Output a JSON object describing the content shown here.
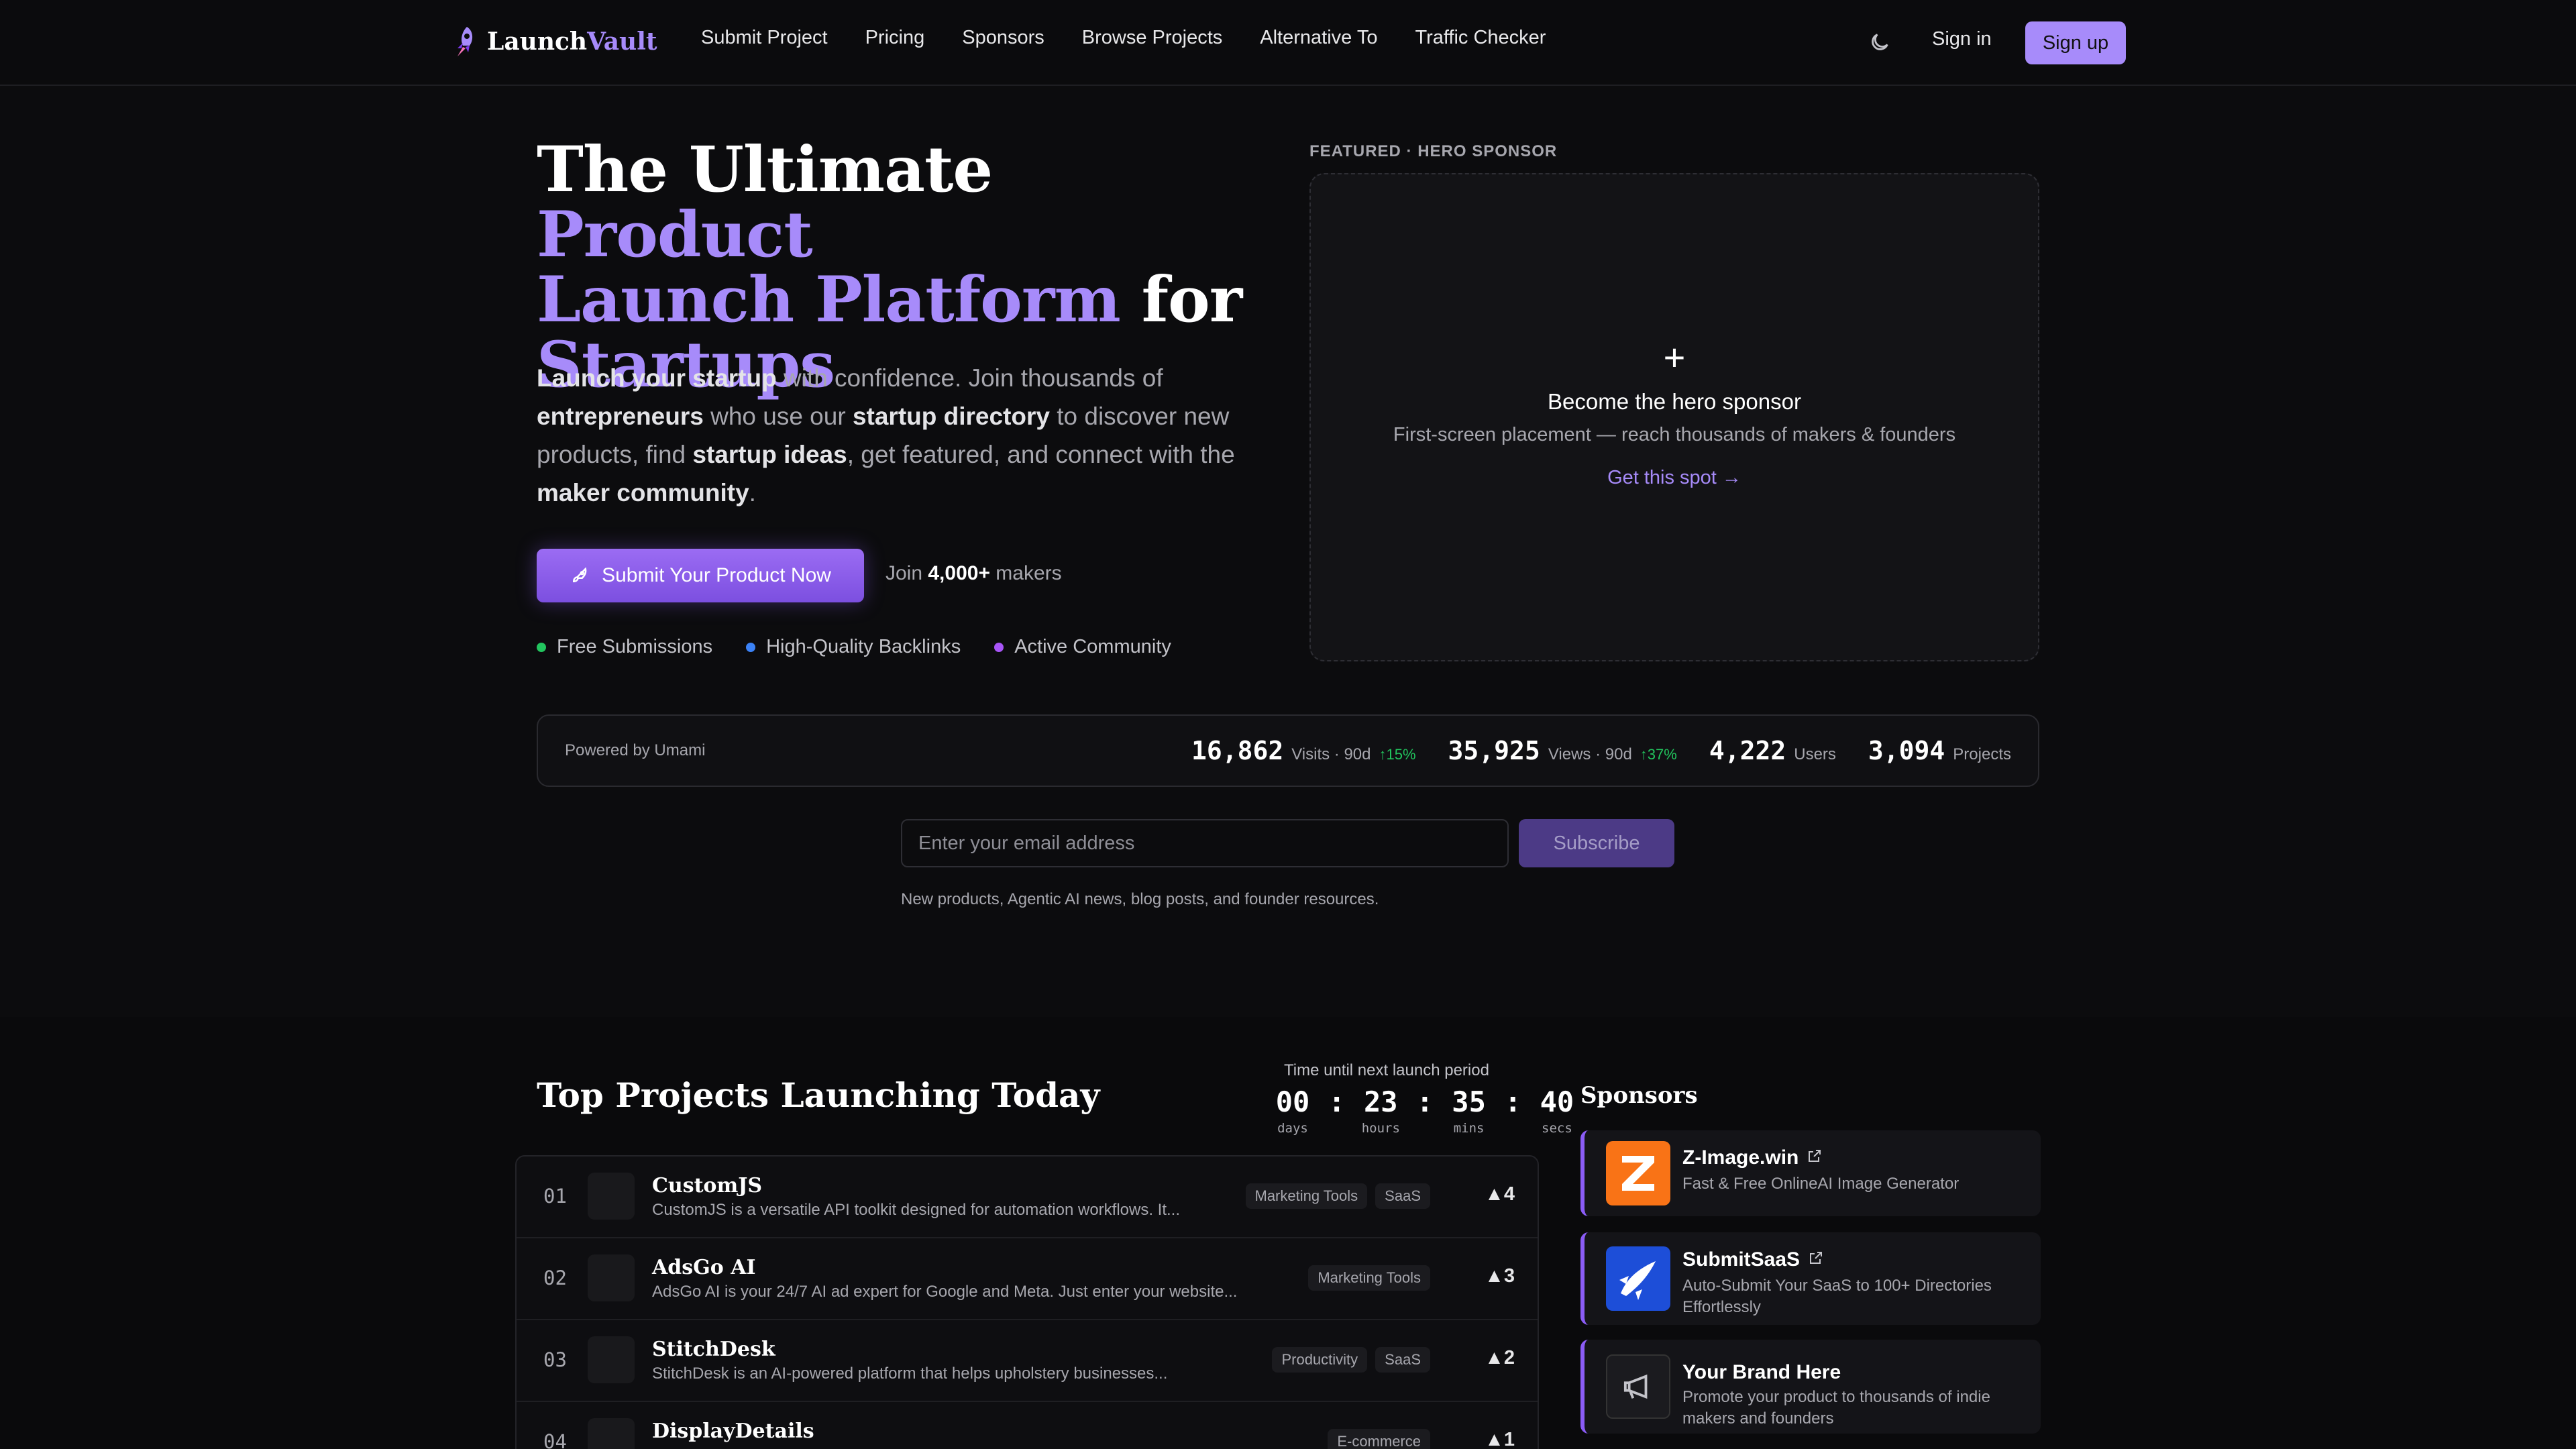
{
  "nav": {
    "logo_part1": "Launch",
    "logo_part2": "Vault",
    "links": [
      "Submit Project",
      "Pricing",
      "Sponsors",
      "Browse Projects",
      "Alternative To",
      "Traffic Checker"
    ],
    "sign_in": "Sign in",
    "sign_up": "Sign up"
  },
  "hero": {
    "title_a": "The Ultimate ",
    "title_b": "Product",
    "title_c": "Launch Platform",
    "title_d": " for",
    "title_e": "Startups",
    "desc": [
      {
        "b": "Launch your startup"
      },
      {
        "t": " with confidence. Join thousands of "
      },
      {
        "b": "entrepreneurs"
      },
      {
        "t": " who use our "
      },
      {
        "b": "startup directory"
      },
      {
        "t": " to discover new products, find "
      },
      {
        "b": "startup ideas"
      },
      {
        "t": ", get featured, and connect with the "
      },
      {
        "b": "maker community"
      },
      {
        "t": "."
      }
    ],
    "cta": "Submit Your Product Now",
    "join_pre": "Join ",
    "join_num": "4,000+",
    "join_post": " makers",
    "bullets": [
      {
        "label": "Free Submissions",
        "color": "#22c55e"
      },
      {
        "label": "High-Quality Backlinks",
        "color": "#3b82f6"
      },
      {
        "label": "Active Community",
        "color": "#a855f7"
      }
    ]
  },
  "hero_sponsor": {
    "label": "FEATURED · HERO SPONSOR",
    "plus": "+",
    "title": "Become the hero sponsor",
    "subtitle": "First-screen placement — reach thousands of makers & founders",
    "link": "Get this spot →"
  },
  "stats": {
    "powered": "Powered by Umami",
    "items": [
      {
        "num": "16,862",
        "label": "Visits · 90d",
        "delta": "↑15%"
      },
      {
        "num": "35,925",
        "label": "Views · 90d",
        "delta": "↑37%"
      },
      {
        "num": "4,222",
        "label": "Users",
        "delta": ""
      },
      {
        "num": "3,094",
        "label": "Projects",
        "delta": ""
      }
    ]
  },
  "newsletter": {
    "placeholder": "Enter your email address",
    "button": "Subscribe",
    "note": "New products, Agentic AI news, blog posts, and founder resources."
  },
  "launches": {
    "title": "Top Projects Launching Today",
    "timer_label": "Time until next launch period",
    "timer": [
      {
        "n": "00",
        "u": "days"
      },
      {
        "n": "23",
        "u": "hours"
      },
      {
        "n": "35",
        "u": "mins"
      },
      {
        "n": "40",
        "u": "secs"
      }
    ],
    "rows": [
      {
        "rank": "01",
        "name": "CustomJS",
        "desc": "CustomJS is a versatile API toolkit designed for automation workflows. It...",
        "tags": [
          "Marketing Tools",
          "SaaS"
        ],
        "votes": "▲4"
      },
      {
        "rank": "02",
        "name": "AdsGo AI",
        "desc": "AdsGo AI is your 24/7 AI ad expert for Google and Meta. Just enter your website...",
        "tags": [
          "Marketing Tools"
        ],
        "votes": "▲3"
      },
      {
        "rank": "03",
        "name": "StitchDesk",
        "desc": "StitchDesk is an AI-powered platform that helps upholstery businesses...",
        "tags": [
          "Productivity",
          "SaaS"
        ],
        "votes": "▲2"
      },
      {
        "rank": "04",
        "name": "DisplayDetails",
        "desc": "",
        "tags": [
          "E-commerce"
        ],
        "votes": "▲1"
      }
    ]
  },
  "sponsors": {
    "title": "Sponsors",
    "items": [
      {
        "name": "Z-Image.win",
        "desc": "Fast & Free OnlineAI Image Generator",
        "logo_letter": "Z",
        "color": "#f97316"
      },
      {
        "name": "SubmitSaaS",
        "desc": "Auto-Submit Your SaaS to 100+ Directories Effortlessly",
        "logo_letter": "",
        "color": "#1d4ed8"
      },
      {
        "name": "Your Brand Here",
        "desc": "Promote your product to thousands of indie makers and founders",
        "logo_letter": "",
        "color": "#1b1b1f"
      }
    ]
  }
}
